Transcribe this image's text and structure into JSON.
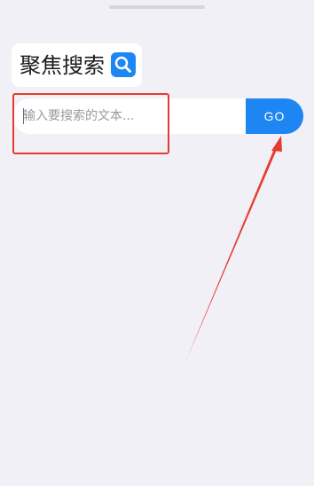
{
  "title": {
    "text": "聚焦搜索",
    "icon": "search-icon"
  },
  "search": {
    "placeholder": "输入要搜索的文本...",
    "value": "",
    "button_label": "GO"
  },
  "colors": {
    "accent": "#1d86f3",
    "background": "#f1f0f6",
    "annotation": "#e63b32"
  }
}
